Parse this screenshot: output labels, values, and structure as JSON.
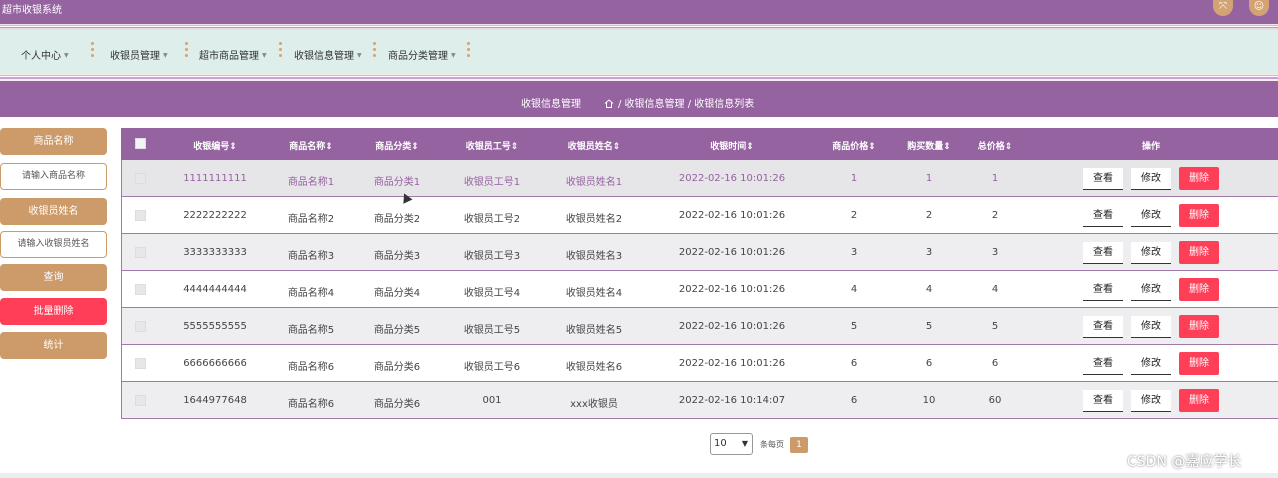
{
  "app": {
    "title": "超市收银系统"
  },
  "topbar": {
    "fullscreen_icon": "expand-icon",
    "user_icon": "user-icon"
  },
  "nav": {
    "items": [
      {
        "label": "个人中心"
      },
      {
        "label": "收银员管理"
      },
      {
        "label": "超市商品管理"
      },
      {
        "label": "收银信息管理"
      },
      {
        "label": "商品分类管理"
      }
    ]
  },
  "breadcrumb": {
    "title": "收银信息管理",
    "path": "/ 收银信息管理 / 收银信息列表"
  },
  "sidebar": {
    "product_name_label": "商品名称",
    "product_name_placeholder": "请输入商品名称",
    "cashier_name_label": "收银员姓名",
    "cashier_name_placeholder": "请输入收银员姓名",
    "search_label": "查询",
    "batch_delete_label": "批量删除",
    "stats_label": "统计"
  },
  "table": {
    "headers": [
      "收银编号",
      "商品名称",
      "商品分类",
      "收银员工号",
      "收银员姓名",
      "收银时间",
      "商品价格",
      "购买数量",
      "总价格",
      "操作"
    ],
    "rows": [
      [
        "1111111111",
        "商品名称1",
        "商品分类1",
        "收银员工号1",
        "收银员姓名1",
        "2022-02-16 10:01:26",
        "1",
        "1",
        "1"
      ],
      [
        "2222222222",
        "商品名称2",
        "商品分类2",
        "收银员工号2",
        "收银员姓名2",
        "2022-02-16 10:01:26",
        "2",
        "2",
        "2"
      ],
      [
        "3333333333",
        "商品名称3",
        "商品分类3",
        "收银员工号3",
        "收银员姓名3",
        "2022-02-16 10:01:26",
        "3",
        "3",
        "3"
      ],
      [
        "4444444444",
        "商品名称4",
        "商品分类4",
        "收银员工号4",
        "收银员姓名4",
        "2022-02-16 10:01:26",
        "4",
        "4",
        "4"
      ],
      [
        "5555555555",
        "商品名称5",
        "商品分类5",
        "收银员工号5",
        "收银员姓名5",
        "2022-02-16 10:01:26",
        "5",
        "5",
        "5"
      ],
      [
        "6666666666",
        "商品名称6",
        "商品分类6",
        "收银员工号6",
        "收银员姓名6",
        "2022-02-16 10:01:26",
        "6",
        "6",
        "6"
      ],
      [
        "1644977648",
        "商品名称6",
        "商品分类6",
        "001",
        "xxx收银员",
        "2022-02-16 10:14:07",
        "6",
        "10",
        "60"
      ]
    ],
    "actions": {
      "view": "查看",
      "edit": "修改",
      "delete": "删除"
    }
  },
  "pagination": {
    "page_size": "10",
    "per_page_label": "条每页",
    "current_page": "1"
  },
  "watermark": "CSDN @嘉应学长",
  "colors": {
    "primary": "#9563a0",
    "accent": "#cc9b69",
    "danger": "#ff3e57"
  }
}
